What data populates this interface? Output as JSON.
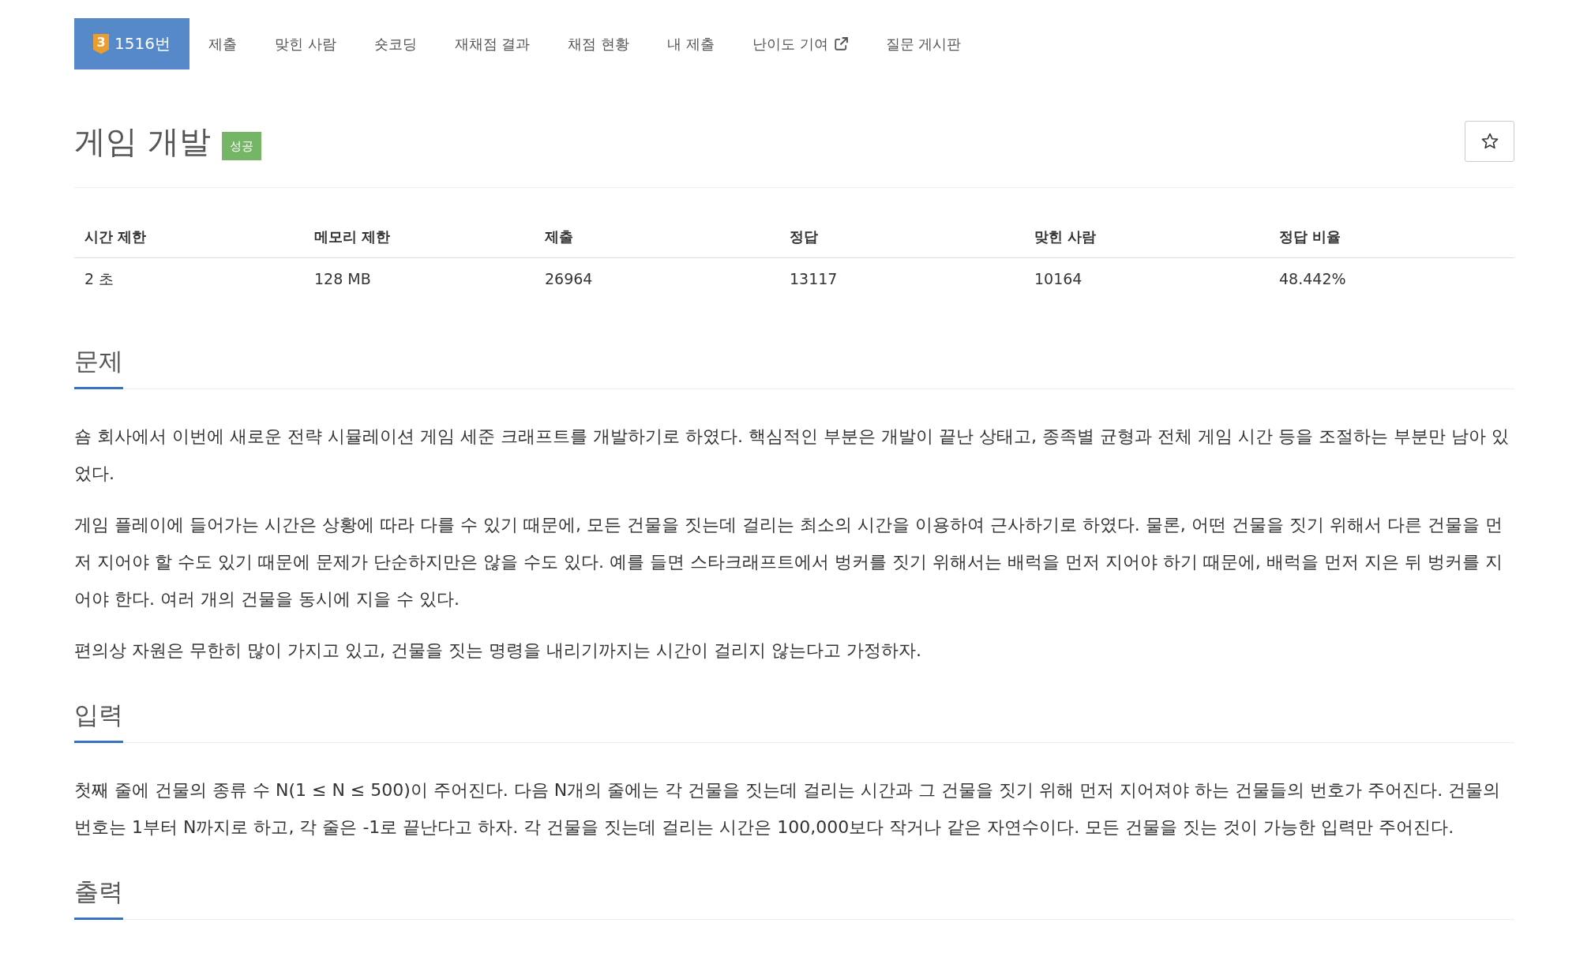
{
  "tabs": [
    {
      "label": "1516번",
      "tier": "3",
      "selected": true,
      "external": false
    },
    {
      "label": "제출",
      "selected": false,
      "external": false
    },
    {
      "label": "맞힌 사람",
      "selected": false,
      "external": false
    },
    {
      "label": "숏코딩",
      "selected": false,
      "external": false
    },
    {
      "label": "재채점 결과",
      "selected": false,
      "external": false
    },
    {
      "label": "채점 현황",
      "selected": false,
      "external": false
    },
    {
      "label": "내 제출",
      "selected": false,
      "external": false
    },
    {
      "label": "난이도 기여",
      "selected": false,
      "external": true
    },
    {
      "label": "질문 게시판",
      "selected": false,
      "external": false
    }
  ],
  "problem": {
    "title": "게임 개발",
    "result_badge": "성공",
    "bookmarked": false
  },
  "info_table": {
    "columns": [
      "시간 제한",
      "메모리 제한",
      "제출",
      "정답",
      "맞힌 사람",
      "정답 비율"
    ],
    "rows": [
      [
        "2 초",
        "128 MB",
        "26964",
        "13117",
        "10164",
        "48.442%"
      ]
    ]
  },
  "sections": [
    {
      "heading": "문제",
      "paragraphs": [
        "숌 회사에서 이번에 새로운 전략 시뮬레이션 게임 세준 크래프트를 개발하기로 하였다. 핵심적인 부분은 개발이 끝난 상태고, 종족별 균형과 전체 게임 시간 등을 조절하는 부분만 남아 있었다.",
        "게임 플레이에 들어가는 시간은 상황에 따라 다를 수 있기 때문에, 모든 건물을 짓는데 걸리는 최소의 시간을 이용하여 근사하기로 하였다. 물론, 어떤 건물을 짓기 위해서 다른 건물을 먼저 지어야 할 수도 있기 때문에 문제가 단순하지만은 않을 수도 있다. 예를 들면 스타크래프트에서 벙커를 짓기 위해서는 배럭을 먼저 지어야 하기 때문에, 배럭을 먼저 지은 뒤 벙커를 지어야 한다. 여러 개의 건물을 동시에 지을 수 있다.",
        "편의상 자원은 무한히 많이 가지고 있고, 건물을 짓는 명령을 내리기까지는 시간이 걸리지 않는다고 가정하자."
      ]
    },
    {
      "heading": "입력",
      "paragraphs": [
        "첫째 줄에 건물의 종류 수 N(1 ≤ N ≤ 500)이 주어진다. 다음 N개의 줄에는 각 건물을 짓는데 걸리는 시간과 그 건물을 짓기 위해 먼저 지어져야 하는 건물들의 번호가 주어진다. 건물의 번호는 1부터 N까지로 하고, 각 줄은 -1로 끝난다고 하자. 각 건물을 짓는데 걸리는 시간은 100,000보다 작거나 같은 자연수이다. 모든 건물을 짓는 것이 가능한 입력만 주어진다."
      ]
    },
    {
      "heading": "출력"
    }
  ]
}
